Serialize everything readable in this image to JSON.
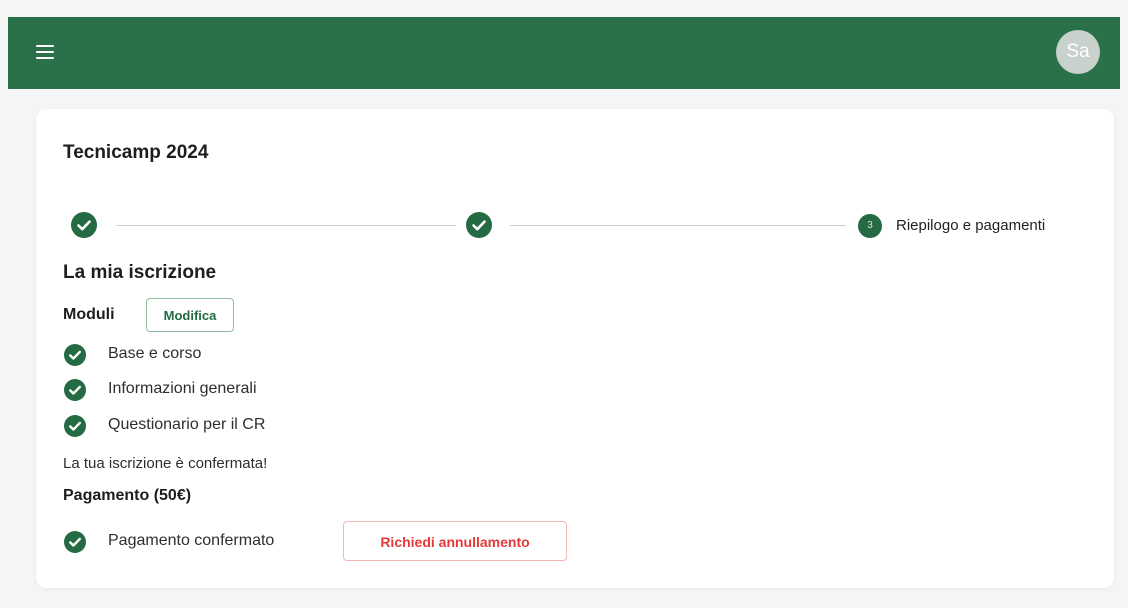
{
  "header": {
    "menu_icon": "hamburger-icon",
    "avatar_initials": "Sa",
    "bar_color": "#2a7048"
  },
  "card": {
    "title": "Tecnicamp 2024",
    "stepper": {
      "steps": [
        {
          "status": "done",
          "icon": "check-icon"
        },
        {
          "status": "done",
          "icon": "check-icon"
        },
        {
          "status": "current",
          "number": "3",
          "label": "Riepilogo e pagamenti"
        }
      ]
    },
    "section_title": "La mia iscrizione",
    "modules": {
      "label": "Moduli",
      "edit_label": "Modifica",
      "items": [
        {
          "label": "Base e corso",
          "icon": "check-circle-icon"
        },
        {
          "label": "Informazioni generali",
          "icon": "check-circle-icon"
        },
        {
          "label": "Questionario per il CR",
          "icon": "check-circle-icon"
        }
      ]
    },
    "confirmation_text": "La tua iscrizione è confermata!",
    "payment": {
      "title": "Pagamento (50€)",
      "status_label": "Pagamento confermato",
      "status_icon": "check-circle-icon",
      "cancel_label": "Richiedi annullamento"
    }
  },
  "colors": {
    "accent": "#246a43",
    "danger": "#e53a3a"
  }
}
